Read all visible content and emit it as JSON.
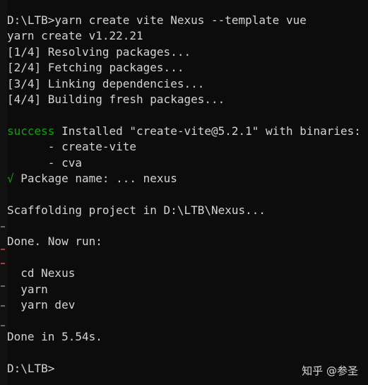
{
  "colors": {
    "background": "#0c0c0c",
    "text": "#d4d4d4",
    "success": "#13a10e"
  },
  "lines": [
    "D:\\LTB>yarn create vite Nexus --template vue",
    "yarn create v1.22.21",
    "[1/4] Resolving packages...",
    "[2/4] Fetching packages...",
    "[3/4] Linking dependencies...",
    "[4/4] Building fresh packages...",
    "",
    "",
    "      - create-vite",
    "      - cva",
    "",
    "",
    "Scaffolding project in D:\\LTB\\Nexus...",
    "",
    "Done. Now run:",
    "",
    "  cd Nexus",
    "  yarn",
    "  yarn dev",
    "",
    "Done in 5.54s.",
    "",
    "D:\\LTB>"
  ],
  "success_line": {
    "keyword": "success",
    "text": " Installed \"create-vite@5.2.1\" with binaries:"
  },
  "prompt_line": {
    "check": "√",
    "text": " Package name: ... nexus"
  },
  "watermark": "知乎 @参圣"
}
